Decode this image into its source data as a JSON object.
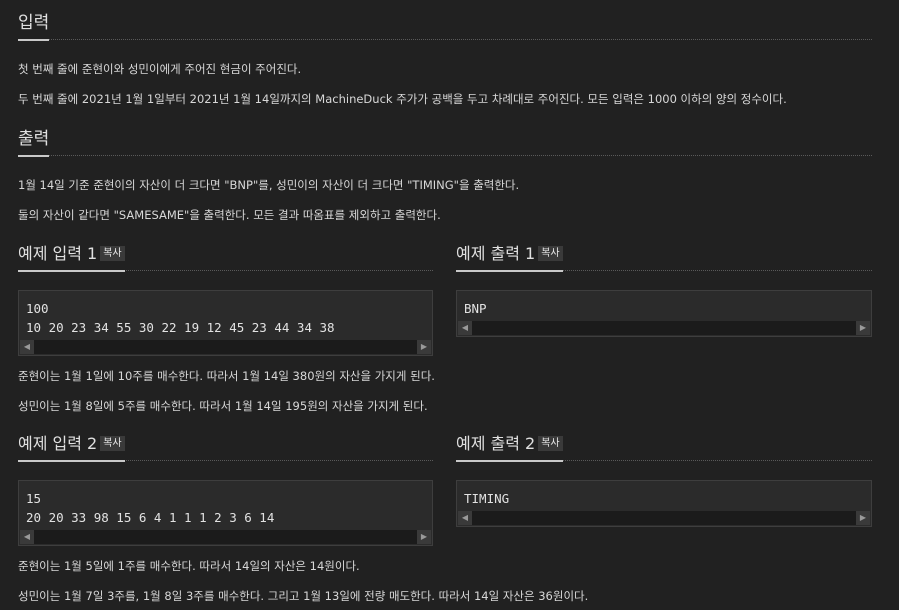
{
  "input_section": {
    "title": "입력",
    "para1": "첫 번째 줄에 준현이와 성민이에게 주어진 현금이 주어진다.",
    "para2": "두 번째 줄에 2021년 1월 1일부터 2021년 1월 14일까지의 MachineDuck 주가가 공백을 두고 차례대로 주어진다. 모든 입력은 1000 이하의 양의 정수이다."
  },
  "output_section": {
    "title": "출력",
    "para1": "1월 14일 기준 준현이의 자산이 더 크다면 \"BNP\"를, 성민이의 자산이 더 크다면 \"TIMING\"을 출력한다.",
    "para2": "둘의 자산이 같다면 \"SAMESAME\"을 출력한다. 모든 결과 따옴표를 제외하고 출력한다."
  },
  "copy_label": "복사",
  "sample1": {
    "input_title": "예제 입력 1",
    "output_title": "예제 출력 1",
    "input_line1": "100",
    "input_line2": "10 20 23 34 55 30 22 19 12 45 23 44 34 38",
    "output_line1": "BNP",
    "note1": "준현이는 1월 1일에 10주를 매수한다. 따라서 1월 14일 380원의 자산을 가지게 된다.",
    "note2": "성민이는 1월 8일에 5주를 매수한다. 따라서 1월 14일 195원의 자산을 가지게 된다."
  },
  "sample2": {
    "input_title": "예제 입력 2",
    "output_title": "예제 출력 2",
    "input_line1": "15",
    "input_line2": "20 20 33 98 15 6 4 1 1 1 2 3 6 14",
    "output_line1": "TIMING",
    "note1": "준현이는 1월 5일에 1주를 매수한다. 따라서 14일의 자산은 14원이다.",
    "note2": "성민이는 1월 7일 3주를, 1월 8일 3주를 매수한다. 그리고 1월 13일에 전량 매도한다. 따라서 14일 자산은 36원이다."
  },
  "icons": {
    "scroll_left": "scroll-left-arrow-icon",
    "scroll_right": "scroll-right-arrow-icon"
  }
}
